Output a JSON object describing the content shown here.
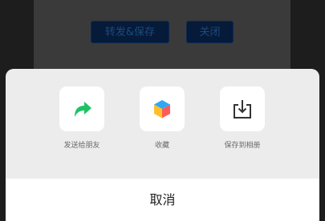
{
  "background": {
    "forward_save_label": "转发&保存",
    "close_label": "关闭"
  },
  "share_sheet": {
    "items": [
      {
        "label": "发送给朋友",
        "icon": "share-arrow-icon",
        "color": "#1ec266"
      },
      {
        "label": "收藏",
        "icon": "favorites-cube-icon",
        "color": "#ff5a5a"
      },
      {
        "label": "保存到相册",
        "icon": "save-to-album-icon",
        "color": "#333333"
      }
    ],
    "cancel_label": "取消"
  }
}
